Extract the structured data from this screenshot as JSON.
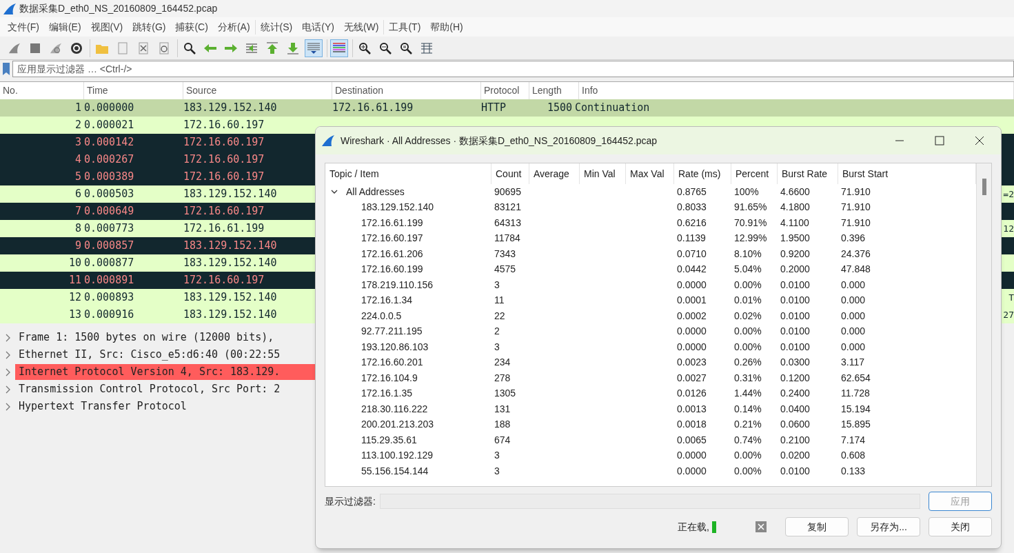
{
  "window": {
    "title": "数据采集D_eth0_NS_20160809_164452.pcap"
  },
  "menu": [
    "文件(F)",
    "编辑(E)",
    "视图(V)",
    "跳转(G)",
    "捕获(C)",
    "分析(A)",
    "统计(S)",
    "电话(Y)",
    "无线(W)",
    "工具(T)",
    "帮助(H)"
  ],
  "toolbar": [
    [
      {
        "selected": false
      },
      {
        "selected": false
      },
      {
        "selected": false
      },
      {
        "selected": false
      }
    ],
    [
      {
        "selected": false
      },
      {
        "selected": false
      },
      {
        "selected": false
      },
      {
        "selected": false
      }
    ],
    [
      {
        "selected": false
      },
      {
        "selected": false
      },
      {
        "selected": false
      },
      {
        "selected": false
      },
      {
        "selected": false
      },
      {
        "selected": false
      },
      {
        "selected": true
      }
    ],
    [
      {
        "selected": true
      }
    ],
    [
      {
        "selected": false
      },
      {
        "selected": false
      },
      {
        "selected": false
      },
      {
        "selected": false
      }
    ]
  ],
  "filter": {
    "placeholder": "应用显示过滤器 … <Ctrl-/>"
  },
  "packet_list": {
    "columns": [
      "No.",
      "Time",
      "Source",
      "Destination",
      "Protocol",
      "Length",
      "Info"
    ],
    "rows": [
      {
        "no": "1",
        "time": "0.000000",
        "source": "183.129.152.140",
        "destination": "172.16.61.199",
        "protocol": "HTTP",
        "length": "1500",
        "info": "Continuation",
        "kind": "selected"
      },
      {
        "no": "2",
        "time": "0.000021",
        "source": "172.16.60.197",
        "kind": "light"
      },
      {
        "no": "3",
        "time": "0.000142",
        "source": "172.16.60.197",
        "kind": "dark"
      },
      {
        "no": "4",
        "time": "0.000267",
        "source": "172.16.60.197",
        "kind": "dark"
      },
      {
        "no": "5",
        "time": "0.000389",
        "source": "172.16.60.197",
        "kind": "dark"
      },
      {
        "no": "6",
        "time": "0.000503",
        "source": "183.129.152.140",
        "info_tail": "=2",
        "kind": "light"
      },
      {
        "no": "7",
        "time": "0.000649",
        "source": "172.16.60.197",
        "kind": "dark"
      },
      {
        "no": "8",
        "time": "0.000773",
        "source": "172.16.61.199",
        "info_tail": "12",
        "kind": "light"
      },
      {
        "no": "9",
        "time": "0.000857",
        "source": "183.129.152.140",
        "kind": "dark"
      },
      {
        "no": "10",
        "time": "0.000877",
        "source": "183.129.152.140",
        "kind": "light"
      },
      {
        "no": "11",
        "time": "0.000891",
        "source": "172.16.60.197",
        "kind": "dark"
      },
      {
        "no": "12",
        "time": "0.000893",
        "source": "183.129.152.140",
        "info_tail": "T",
        "kind": "light"
      },
      {
        "no": "13",
        "time": "0.000916",
        "source": "183.129.152.140",
        "info_tail": "27",
        "kind": "light"
      }
    ]
  },
  "details": [
    {
      "text": "Frame 1: 1500 bytes on wire (12000 bits),",
      "selected": false
    },
    {
      "text": "Ethernet II, Src: Cisco_e5:d6:40 (00:22:55",
      "selected": false
    },
    {
      "text": "Internet Protocol Version 4, Src: 183.129.",
      "selected": true
    },
    {
      "text": "Transmission Control Protocol, Src Port: 2",
      "selected": false
    },
    {
      "text": "Hypertext Transfer Protocol",
      "selected": false
    }
  ],
  "dialog": {
    "title": "Wireshark · All Addresses · 数据采集D_eth0_NS_20160809_164452.pcap",
    "columns": [
      "Topic / Item",
      "Count",
      "Average",
      "Min Val",
      "Max Val",
      "Rate (ms)",
      "Percent",
      "Burst Rate",
      "Burst Start"
    ],
    "tree": [
      {
        "item": "All Addresses",
        "count": "90695",
        "rate": "0.8765",
        "percent": "100%",
        "burst_rate": "4.6600",
        "burst_start": "71.910",
        "expanded": true,
        "children": [
          {
            "item": "183.129.152.140",
            "count": "83121",
            "rate": "0.8033",
            "percent": "91.65%",
            "burst_rate": "4.1800",
            "burst_start": "71.910"
          },
          {
            "item": "172.16.61.199",
            "count": "64313",
            "rate": "0.6216",
            "percent": "70.91%",
            "burst_rate": "4.1100",
            "burst_start": "71.910"
          },
          {
            "item": "172.16.60.197",
            "count": "11784",
            "rate": "0.1139",
            "percent": "12.99%",
            "burst_rate": "1.9500",
            "burst_start": "0.396"
          },
          {
            "item": "172.16.61.206",
            "count": "7343",
            "rate": "0.0710",
            "percent": "8.10%",
            "burst_rate": "0.9200",
            "burst_start": "24.376"
          },
          {
            "item": "172.16.60.199",
            "count": "4575",
            "rate": "0.0442",
            "percent": "5.04%",
            "burst_rate": "0.2000",
            "burst_start": "47.848"
          },
          {
            "item": "178.219.110.156",
            "count": "3",
            "rate": "0.0000",
            "percent": "0.00%",
            "burst_rate": "0.0100",
            "burst_start": "0.000"
          },
          {
            "item": "172.16.1.34",
            "count": "11",
            "rate": "0.0001",
            "percent": "0.01%",
            "burst_rate": "0.0100",
            "burst_start": "0.000"
          },
          {
            "item": "224.0.0.5",
            "count": "22",
            "rate": "0.0002",
            "percent": "0.02%",
            "burst_rate": "0.0100",
            "burst_start": "0.000"
          },
          {
            "item": "92.77.211.195",
            "count": "2",
            "rate": "0.0000",
            "percent": "0.00%",
            "burst_rate": "0.0100",
            "burst_start": "0.000"
          },
          {
            "item": "193.120.86.103",
            "count": "3",
            "rate": "0.0000",
            "percent": "0.00%",
            "burst_rate": "0.0100",
            "burst_start": "0.000"
          },
          {
            "item": "172.16.60.201",
            "count": "234",
            "rate": "0.0023",
            "percent": "0.26%",
            "burst_rate": "0.0300",
            "burst_start": "3.117"
          },
          {
            "item": "172.16.104.9",
            "count": "278",
            "rate": "0.0027",
            "percent": "0.31%",
            "burst_rate": "0.1200",
            "burst_start": "62.654"
          },
          {
            "item": "172.16.1.35",
            "count": "1305",
            "rate": "0.0126",
            "percent": "1.44%",
            "burst_rate": "0.2400",
            "burst_start": "11.728"
          },
          {
            "item": "218.30.116.222",
            "count": "131",
            "rate": "0.0013",
            "percent": "0.14%",
            "burst_rate": "0.0400",
            "burst_start": "15.194"
          },
          {
            "item": "200.201.213.203",
            "count": "188",
            "rate": "0.0018",
            "percent": "0.21%",
            "burst_rate": "0.0600",
            "burst_start": "15.895"
          },
          {
            "item": "115.29.35.61",
            "count": "674",
            "rate": "0.0065",
            "percent": "0.74%",
            "burst_rate": "0.2100",
            "burst_start": "7.174"
          },
          {
            "item": "113.100.192.129",
            "count": "3",
            "rate": "0.0000",
            "percent": "0.00%",
            "burst_rate": "0.0200",
            "burst_start": "0.608"
          },
          {
            "item": "55.156.154.144",
            "count": "3",
            "rate": "0.0000",
            "percent": "0.00%",
            "burst_rate": "0.0100",
            "burst_start": "0.133"
          }
        ]
      }
    ],
    "filter_label": "显示过滤器:",
    "apply_button": "应用",
    "status": "正在载,",
    "buttons": [
      "复制",
      "另存为...",
      "关闭"
    ]
  }
}
